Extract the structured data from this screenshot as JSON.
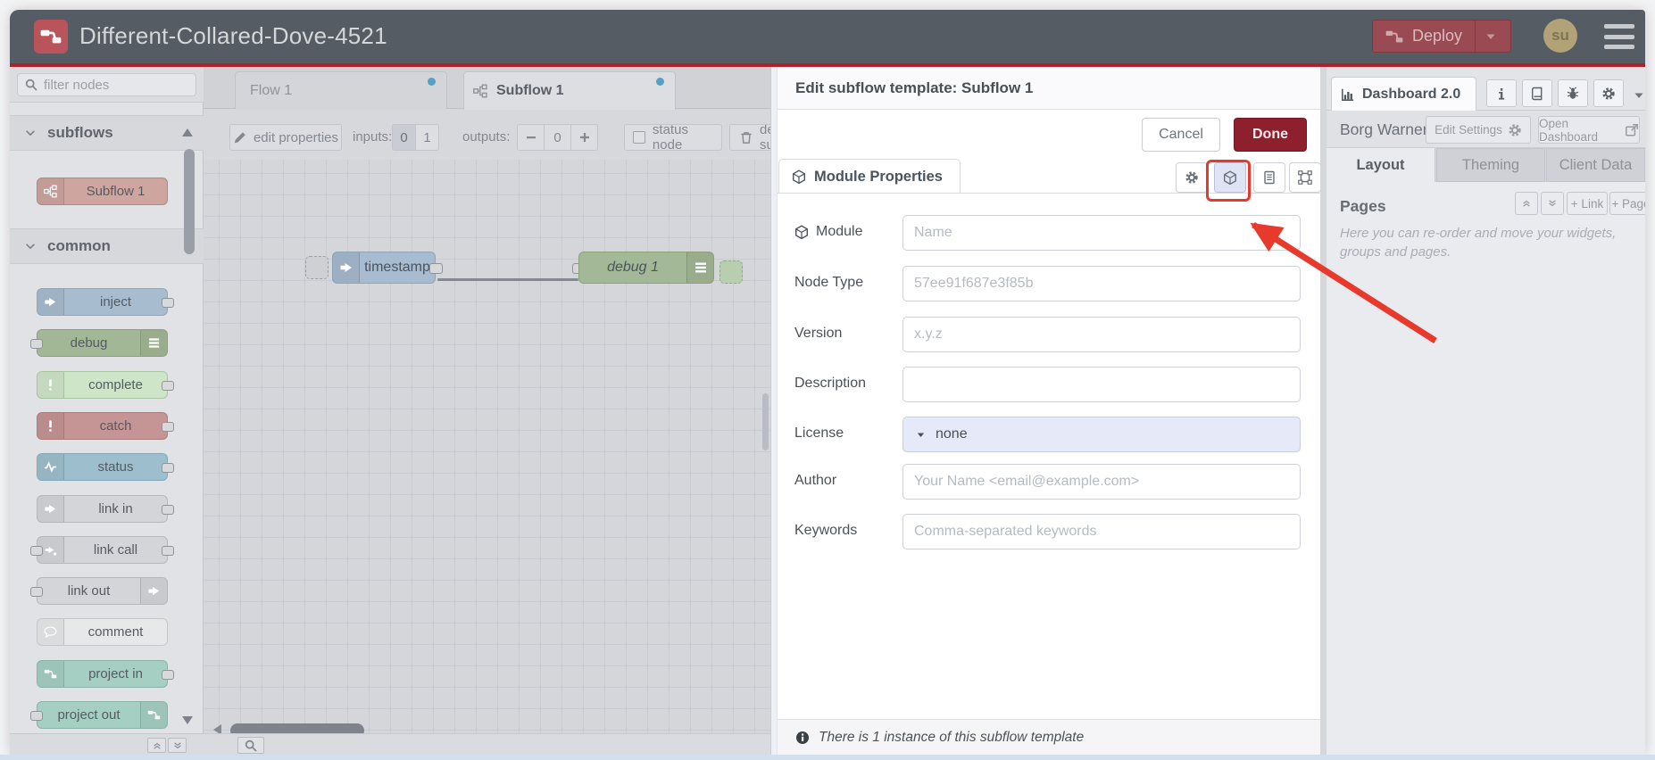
{
  "window": {
    "title": "Different-Collared-Dove-4521"
  },
  "header": {
    "deploy_label": "Deploy",
    "avatar_text": "su",
    "accent_red": "#b21e29",
    "deploy_bg": "#9a4a52"
  },
  "palette": {
    "filter_placeholder": "filter nodes",
    "categories": [
      {
        "label": "subflows",
        "nodes": [
          {
            "label": "Subflow 1",
            "color": "#cfa5a0",
            "border": "#ab8984",
            "icon": "subflow",
            "iconSide": "left",
            "portLeft": false,
            "portRight": false
          }
        ]
      },
      {
        "label": "common",
        "nodes": [
          {
            "label": "inject",
            "color": "#a8bccf",
            "border": "#8fa6bc",
            "icon": "inject",
            "iconSide": "left",
            "portLeft": false,
            "portRight": true
          },
          {
            "label": "debug",
            "color": "#a2b795",
            "border": "#8aa07e",
            "icon": "debug",
            "iconSide": "right",
            "portLeft": true,
            "portRight": false
          },
          {
            "label": "complete",
            "color": "#cfe5c8",
            "border": "#aac4a2",
            "icon": "exclaim",
            "iconSide": "left",
            "portLeft": false,
            "portRight": true
          },
          {
            "label": "catch",
            "color": "#c59494",
            "border": "#a87f7f",
            "icon": "exclaim",
            "iconSide": "left",
            "portLeft": false,
            "portRight": true
          },
          {
            "label": "status",
            "color": "#9dbfcd",
            "border": "#85a8b8",
            "icon": "status",
            "iconSide": "left",
            "portLeft": false,
            "portRight": true
          },
          {
            "label": "link in",
            "color": "#d4d5d8",
            "border": "#b5b7bb",
            "icon": "inject",
            "iconSide": "left",
            "portLeft": false,
            "portRight": true
          },
          {
            "label": "link call",
            "color": "#d4d5d8",
            "border": "#b5b7bb",
            "icon": "linkcall",
            "iconSide": "left",
            "portLeft": true,
            "portRight": true
          },
          {
            "label": "link out",
            "color": "#d4d5d8",
            "border": "#b5b7bb",
            "icon": "inject",
            "iconSide": "right",
            "portLeft": true,
            "portRight": false
          },
          {
            "label": "comment",
            "color": "#e7e8ea",
            "border": "#c4c6c9",
            "icon": "comment",
            "iconSide": "left",
            "portLeft": false,
            "portRight": false
          },
          {
            "label": "project in",
            "color": "#a5cfc3",
            "border": "#8ab3a7",
            "icon": "project",
            "iconSide": "left",
            "portLeft": false,
            "portRight": true
          },
          {
            "label": "project out",
            "color": "#a5cfc3",
            "border": "#8ab3a7",
            "icon": "project",
            "iconSide": "right",
            "portLeft": true,
            "portRight": false
          }
        ]
      }
    ]
  },
  "workspace": {
    "tabs": [
      {
        "label": "Flow 1",
        "active": false,
        "dot": true
      },
      {
        "label": "Subflow 1",
        "active": true,
        "dot": true
      }
    ],
    "toolbar": {
      "edit_properties": "edit properties",
      "inputs_label": "inputs:",
      "inputs_options": [
        "0",
        "1"
      ],
      "inputs_selected": "0",
      "outputs_label": "outputs:",
      "outputs_value": "0",
      "status_node_label": "status node",
      "delete_label": "delete subflow"
    },
    "nodes": [
      {
        "label": "timestamp",
        "type": "inject"
      },
      {
        "label": "debug 1",
        "type": "debug"
      }
    ]
  },
  "dialog": {
    "title": "Edit subflow template: Subflow 1",
    "cancel_label": "Cancel",
    "done_label": "Done",
    "tab_label": "Module Properties",
    "fields": [
      {
        "label": "Module",
        "icon": "cube",
        "placeholder": "Name",
        "value": ""
      },
      {
        "label": "Node Type",
        "placeholder": "57ee91f687e3f85b",
        "value": ""
      },
      {
        "label": "Version",
        "placeholder": "x.y.z",
        "value": ""
      },
      {
        "label": "Description",
        "placeholder": "",
        "value": ""
      },
      {
        "label": "License",
        "type": "select",
        "value": "none"
      },
      {
        "label": "Author",
        "placeholder": "Your Name <email@example.com>",
        "value": ""
      },
      {
        "label": "Keywords",
        "placeholder": "Comma-separated keywords",
        "value": ""
      }
    ],
    "footer_text": "There is 1 instance of this subflow template",
    "highlight_color": "#e8392d"
  },
  "sidebar": {
    "tab_label": "Dashboard 2.0",
    "owner": "Borg Warner",
    "edit_settings_label": "Edit Settings",
    "open_dashboard_label": "Open Dashboard",
    "subtabs": [
      "Layout",
      "Theming",
      "Client Data"
    ],
    "active_subtab": "Layout",
    "pages_title": "Pages",
    "link_button_label": "+ Link",
    "page_button_label": "+ Page",
    "help_text": "Here you can re-order and move your widgets, groups and pages."
  }
}
